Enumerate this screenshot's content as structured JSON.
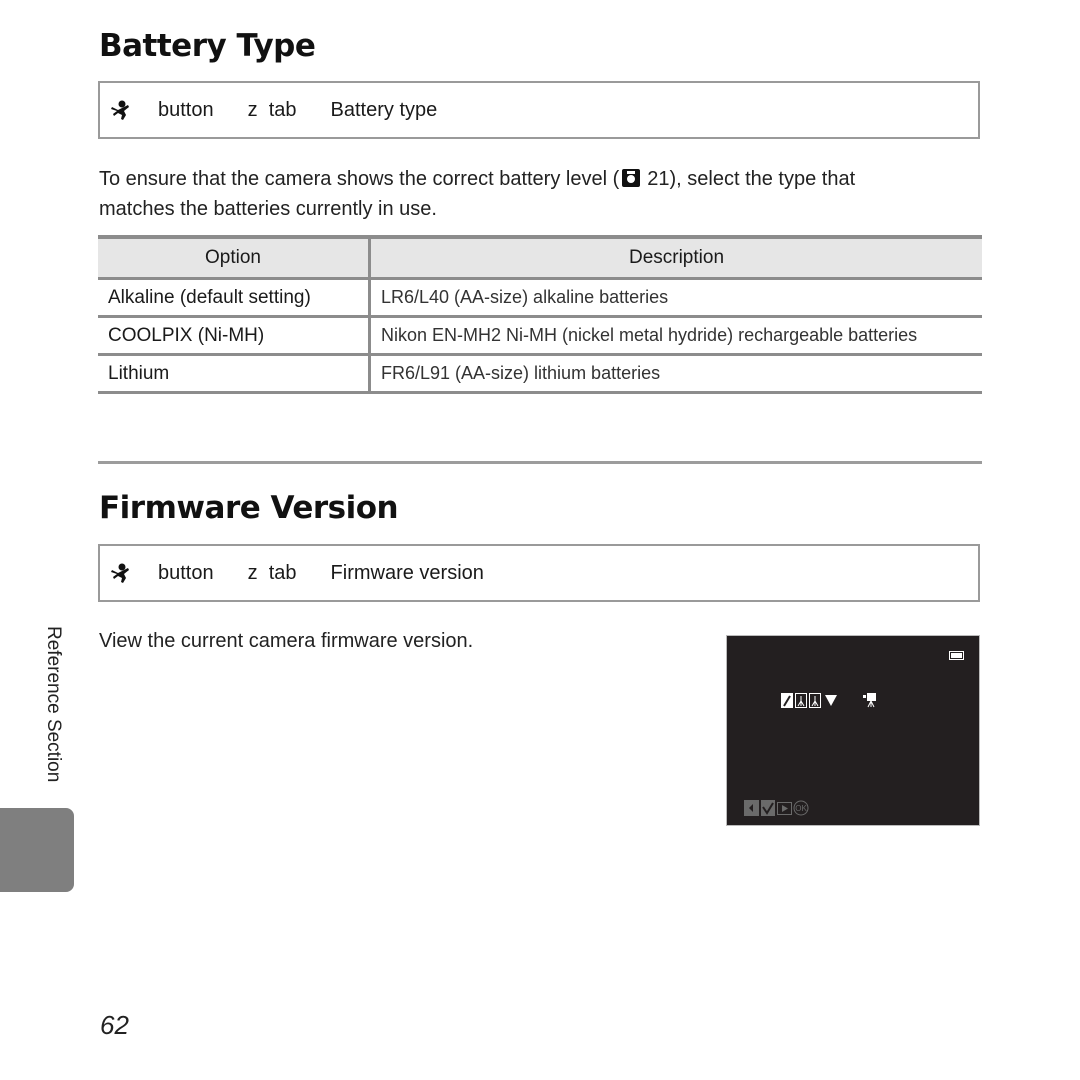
{
  "sections": {
    "battery": {
      "title": "Battery Type",
      "procedure": {
        "icon": "setup-menu-icon",
        "step1": "button",
        "step2": "z  tab",
        "step3": "Battery type"
      },
      "intro_before": "To ensure that the camera shows the correct battery level (",
      "ref_icon": "camera-reference-icon",
      "intro_ref_page": "21), select the type that",
      "intro_line2": "matches the batteries currently in use.",
      "table": {
        "headers": [
          "Option",
          "Description"
        ],
        "rows": [
          {
            "option": "Alkaline (default setting)",
            "description": "LR6/L40 (AA-size) alkaline batteries"
          },
          {
            "option": "COOLPIX (Ni-MH)",
            "description": "Nikon EN-MH2 Ni-MH (nickel metal hydride) rechargeable batteries"
          },
          {
            "option": "Lithium",
            "description": "FR6/L91 (AA-size) lithium batteries"
          }
        ]
      }
    },
    "firmware": {
      "title": "Firmware Version",
      "procedure": {
        "icon": "setup-menu-icon",
        "step1": "button",
        "step2": "z  tab",
        "step3": "Firmware version"
      },
      "description": "View the current camera firmware version.",
      "screen": {
        "icons": [
          "battery-indicator-icon",
          "edit-icon",
          "tripod-icon",
          "tripod-icon",
          "down-triangle-icon",
          "movie-camera-icon",
          "left-arrow-icon",
          "check-icon",
          "play-icon",
          "ok-icon"
        ]
      }
    }
  },
  "sidebar": {
    "label": "Reference Section"
  },
  "footer": {
    "page_number": "62"
  }
}
